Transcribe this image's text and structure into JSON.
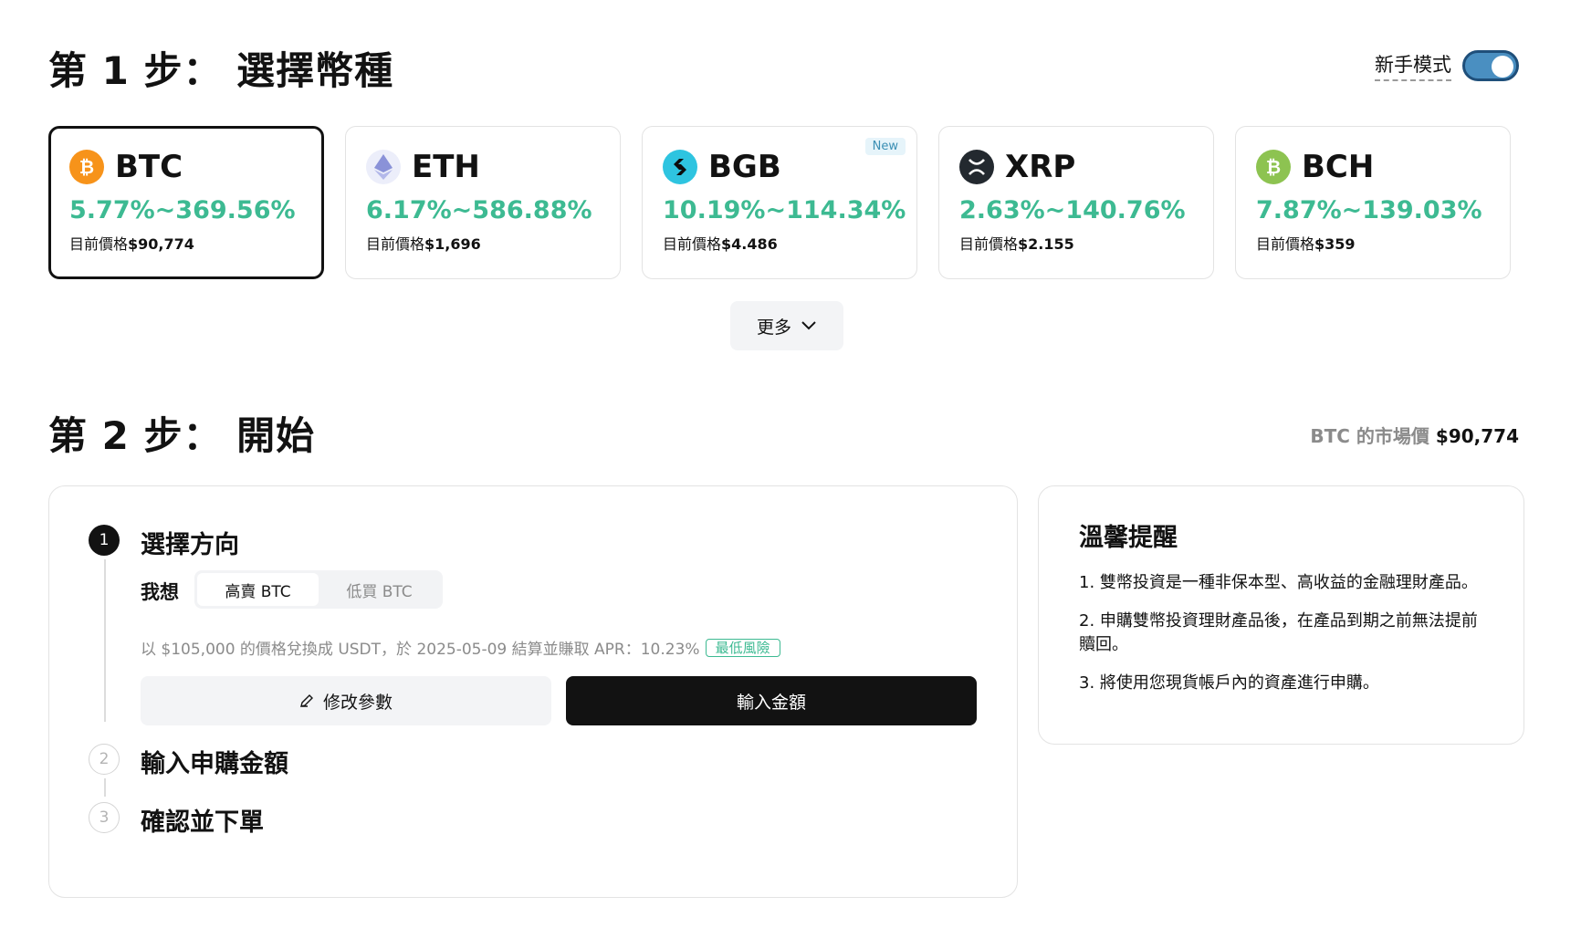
{
  "step1": {
    "title": "第 1 步： 選擇幣種"
  },
  "mode": {
    "label": "新手模式",
    "enabled": true
  },
  "coins": [
    {
      "symbol": "BTC",
      "range": "5.77%~369.56%",
      "price_label": "目前價格",
      "price": "$90,774",
      "selected": true,
      "icon": "bitcoin-icon",
      "color": "#f7931a",
      "badge": ""
    },
    {
      "symbol": "ETH",
      "range": "6.17%~586.88%",
      "price_label": "目前價格",
      "price": "$1,696",
      "selected": false,
      "icon": "ethereum-icon",
      "color": "#8a92d8",
      "badge": ""
    },
    {
      "symbol": "BGB",
      "range": "10.19%~114.34%",
      "price_label": "目前價格",
      "price": "$4.486",
      "selected": false,
      "icon": "bitget-icon",
      "color": "#2ec4e0",
      "badge": "New"
    },
    {
      "symbol": "XRP",
      "range": "2.63%~140.76%",
      "price_label": "目前價格",
      "price": "$2.155",
      "selected": false,
      "icon": "xrp-icon",
      "color": "#23292f",
      "badge": ""
    },
    {
      "symbol": "BCH",
      "range": "7.87%~139.03%",
      "price_label": "目前價格",
      "price": "$359",
      "selected": false,
      "icon": "bitcoin-cash-icon",
      "color": "#8dc351",
      "badge": ""
    }
  ],
  "more": {
    "label": "更多"
  },
  "step2": {
    "title": "第 2 步： 開始",
    "market_label": "BTC 的市場價",
    "market_value": "$90,774"
  },
  "flow": {
    "steps": [
      {
        "num": "1",
        "title": "選擇方向"
      },
      {
        "num": "2",
        "title": "輸入申購金額"
      },
      {
        "num": "3",
        "title": "確認並下單"
      }
    ],
    "want_label": "我想",
    "directions": [
      "高賣 BTC",
      "低買 BTC"
    ],
    "active_direction": 0,
    "description": "以 $105,000 的價格兌換成 USDT，於 2025-05-09 結算並賺取 APR：10.23%",
    "risk_badge": "最低風險",
    "edit_label": "修改參數",
    "enter_amount_label": "輸入金額"
  },
  "reminder": {
    "title": "溫馨提醒",
    "items": [
      "1. 雙幣投資是一種非保本型、高收益的金融理財產品。",
      "2. 申購雙幣投資理財產品後，在產品到期之前無法提前贖回。",
      "3. 將使用您現貨帳戶內的資產進行申購。"
    ]
  },
  "colors": {
    "accent_green": "#3dba92",
    "toggle_blue": "#4a8fc1",
    "dark": "#121212"
  }
}
